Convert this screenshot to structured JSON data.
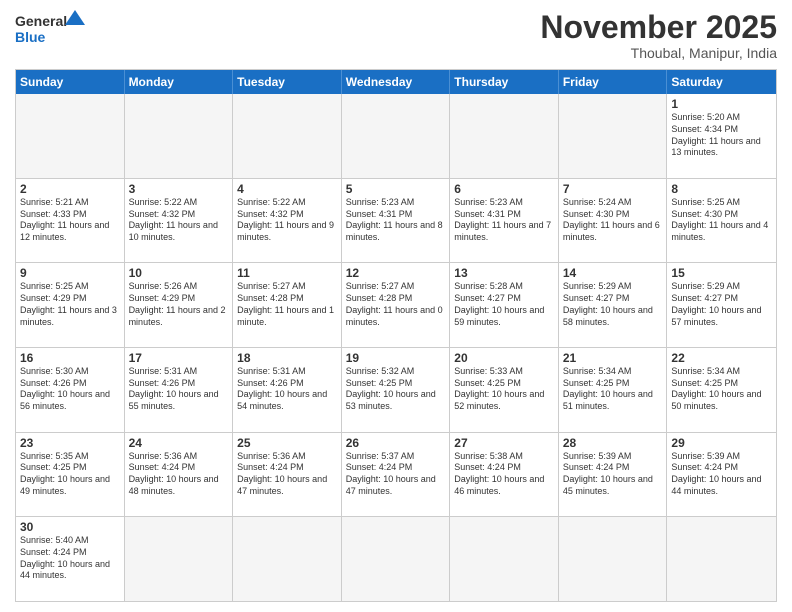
{
  "header": {
    "logo_general": "General",
    "logo_blue": "Blue",
    "month_title": "November 2025",
    "location": "Thoubal, Manipur, India"
  },
  "days": [
    "Sunday",
    "Monday",
    "Tuesday",
    "Wednesday",
    "Thursday",
    "Friday",
    "Saturday"
  ],
  "weeks": [
    [
      {
        "date": "",
        "info": ""
      },
      {
        "date": "",
        "info": ""
      },
      {
        "date": "",
        "info": ""
      },
      {
        "date": "",
        "info": ""
      },
      {
        "date": "",
        "info": ""
      },
      {
        "date": "",
        "info": ""
      },
      {
        "date": "1",
        "info": "Sunrise: 5:20 AM\nSunset: 4:34 PM\nDaylight: 11 hours and 13 minutes."
      }
    ],
    [
      {
        "date": "2",
        "info": "Sunrise: 5:21 AM\nSunset: 4:33 PM\nDaylight: 11 hours and 12 minutes."
      },
      {
        "date": "3",
        "info": "Sunrise: 5:22 AM\nSunset: 4:32 PM\nDaylight: 11 hours and 10 minutes."
      },
      {
        "date": "4",
        "info": "Sunrise: 5:22 AM\nSunset: 4:32 PM\nDaylight: 11 hours and 9 minutes."
      },
      {
        "date": "5",
        "info": "Sunrise: 5:23 AM\nSunset: 4:31 PM\nDaylight: 11 hours and 8 minutes."
      },
      {
        "date": "6",
        "info": "Sunrise: 5:23 AM\nSunset: 4:31 PM\nDaylight: 11 hours and 7 minutes."
      },
      {
        "date": "7",
        "info": "Sunrise: 5:24 AM\nSunset: 4:30 PM\nDaylight: 11 hours and 6 minutes."
      },
      {
        "date": "8",
        "info": "Sunrise: 5:25 AM\nSunset: 4:30 PM\nDaylight: 11 hours and 4 minutes."
      }
    ],
    [
      {
        "date": "9",
        "info": "Sunrise: 5:25 AM\nSunset: 4:29 PM\nDaylight: 11 hours and 3 minutes."
      },
      {
        "date": "10",
        "info": "Sunrise: 5:26 AM\nSunset: 4:29 PM\nDaylight: 11 hours and 2 minutes."
      },
      {
        "date": "11",
        "info": "Sunrise: 5:27 AM\nSunset: 4:28 PM\nDaylight: 11 hours and 1 minute."
      },
      {
        "date": "12",
        "info": "Sunrise: 5:27 AM\nSunset: 4:28 PM\nDaylight: 11 hours and 0 minutes."
      },
      {
        "date": "13",
        "info": "Sunrise: 5:28 AM\nSunset: 4:27 PM\nDaylight: 10 hours and 59 minutes."
      },
      {
        "date": "14",
        "info": "Sunrise: 5:29 AM\nSunset: 4:27 PM\nDaylight: 10 hours and 58 minutes."
      },
      {
        "date": "15",
        "info": "Sunrise: 5:29 AM\nSunset: 4:27 PM\nDaylight: 10 hours and 57 minutes."
      }
    ],
    [
      {
        "date": "16",
        "info": "Sunrise: 5:30 AM\nSunset: 4:26 PM\nDaylight: 10 hours and 56 minutes."
      },
      {
        "date": "17",
        "info": "Sunrise: 5:31 AM\nSunset: 4:26 PM\nDaylight: 10 hours and 55 minutes."
      },
      {
        "date": "18",
        "info": "Sunrise: 5:31 AM\nSunset: 4:26 PM\nDaylight: 10 hours and 54 minutes."
      },
      {
        "date": "19",
        "info": "Sunrise: 5:32 AM\nSunset: 4:25 PM\nDaylight: 10 hours and 53 minutes."
      },
      {
        "date": "20",
        "info": "Sunrise: 5:33 AM\nSunset: 4:25 PM\nDaylight: 10 hours and 52 minutes."
      },
      {
        "date": "21",
        "info": "Sunrise: 5:34 AM\nSunset: 4:25 PM\nDaylight: 10 hours and 51 minutes."
      },
      {
        "date": "22",
        "info": "Sunrise: 5:34 AM\nSunset: 4:25 PM\nDaylight: 10 hours and 50 minutes."
      }
    ],
    [
      {
        "date": "23",
        "info": "Sunrise: 5:35 AM\nSunset: 4:25 PM\nDaylight: 10 hours and 49 minutes."
      },
      {
        "date": "24",
        "info": "Sunrise: 5:36 AM\nSunset: 4:24 PM\nDaylight: 10 hours and 48 minutes."
      },
      {
        "date": "25",
        "info": "Sunrise: 5:36 AM\nSunset: 4:24 PM\nDaylight: 10 hours and 47 minutes."
      },
      {
        "date": "26",
        "info": "Sunrise: 5:37 AM\nSunset: 4:24 PM\nDaylight: 10 hours and 47 minutes."
      },
      {
        "date": "27",
        "info": "Sunrise: 5:38 AM\nSunset: 4:24 PM\nDaylight: 10 hours and 46 minutes."
      },
      {
        "date": "28",
        "info": "Sunrise: 5:39 AM\nSunset: 4:24 PM\nDaylight: 10 hours and 45 minutes."
      },
      {
        "date": "29",
        "info": "Sunrise: 5:39 AM\nSunset: 4:24 PM\nDaylight: 10 hours and 44 minutes."
      }
    ],
    [
      {
        "date": "30",
        "info": "Sunrise: 5:40 AM\nSunset: 4:24 PM\nDaylight: 10 hours and 44 minutes."
      },
      {
        "date": "",
        "info": ""
      },
      {
        "date": "",
        "info": ""
      },
      {
        "date": "",
        "info": ""
      },
      {
        "date": "",
        "info": ""
      },
      {
        "date": "",
        "info": ""
      },
      {
        "date": "",
        "info": ""
      }
    ]
  ]
}
